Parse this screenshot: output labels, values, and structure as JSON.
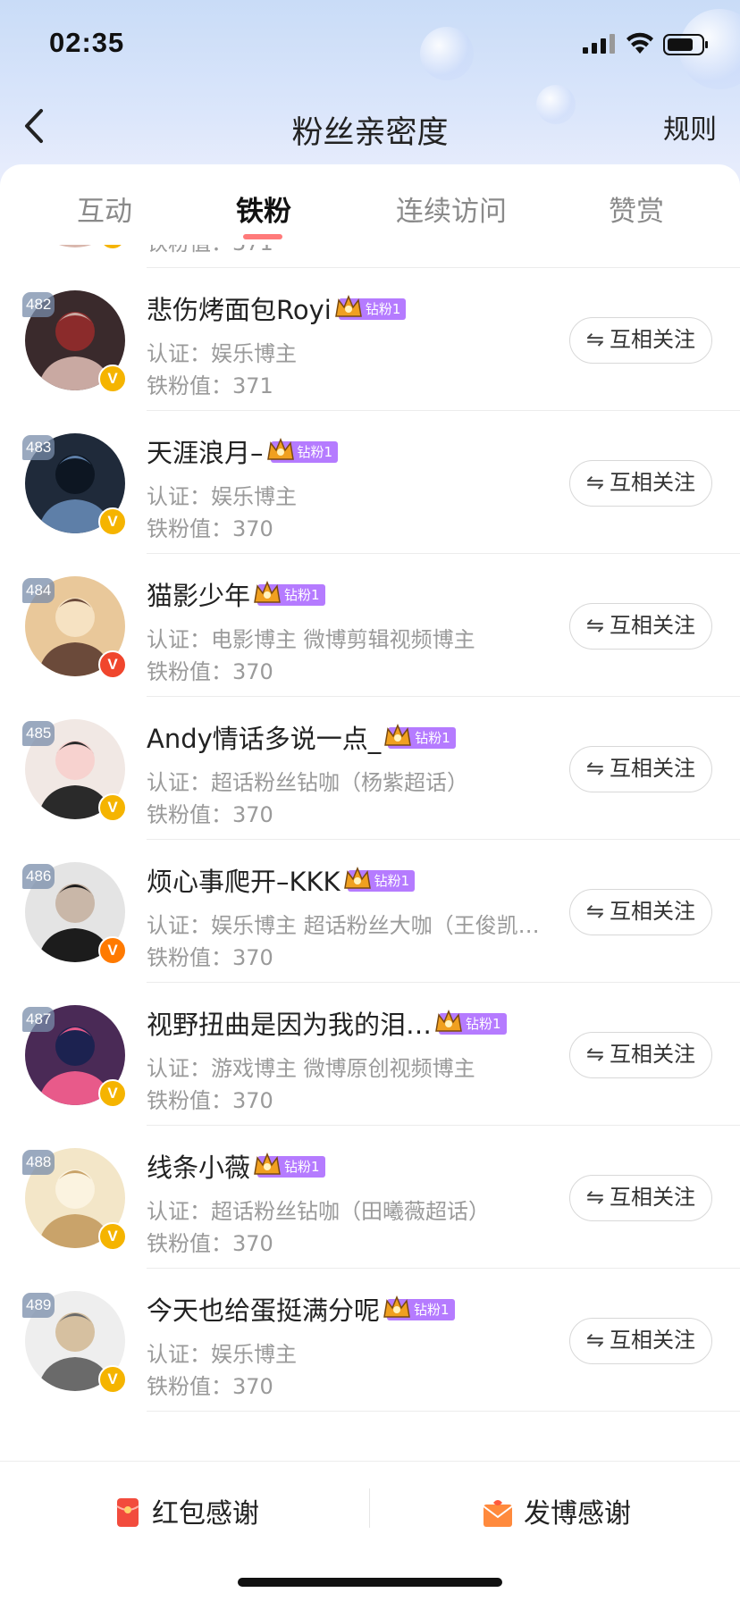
{
  "status": {
    "time": "02:35"
  },
  "nav": {
    "title": "粉丝亲密度",
    "rules": "规则"
  },
  "tabs": [
    {
      "label": "互动",
      "active": false
    },
    {
      "label": "铁粉",
      "active": true
    },
    {
      "label": "连续访问",
      "active": false
    },
    {
      "label": "赞赏",
      "active": false
    }
  ],
  "partial_row": {
    "score": "铁粉值：371"
  },
  "rows": [
    {
      "rank": "482",
      "name": "悲伤烤面包Royi",
      "badge": "钻粉1",
      "cert": "认证：娱乐博主",
      "score": "铁粉值：371",
      "follow": "互相关注",
      "verify": "gold"
    },
    {
      "rank": "483",
      "name": "天涯浪月–",
      "badge": "钻粉1",
      "cert": "认证：娱乐博主",
      "score": "铁粉值：370",
      "follow": "互相关注",
      "verify": "gold"
    },
    {
      "rank": "484",
      "name": "猫影少年",
      "badge": "钻粉1",
      "cert": "认证：电影博主 微博剪辑视频博主",
      "score": "铁粉值：370",
      "follow": "互相关注",
      "verify": "red"
    },
    {
      "rank": "485",
      "name": "Andy情话多说一点_",
      "badge": "钻粉1",
      "cert": "认证：超话粉丝钻咖（杨紫超话）",
      "score": "铁粉值：370",
      "follow": "互相关注",
      "verify": "gold"
    },
    {
      "rank": "486",
      "name": "烦心事爬开–KKK",
      "badge": "钻粉1",
      "cert": "认证：娱乐博主 超话粉丝大咖（王俊凯…",
      "score": "铁粉值：370",
      "follow": "互相关注",
      "verify": "orange"
    },
    {
      "rank": "487",
      "name": "视野扭曲是因为我的泪…",
      "badge": "钻粉1",
      "cert": "认证：游戏博主 微博原创视频博主",
      "score": "铁粉值：370",
      "follow": "互相关注",
      "verify": "gold"
    },
    {
      "rank": "488",
      "name": "线条小薇",
      "badge": "钻粉1",
      "cert": "认证：超话粉丝钻咖（田曦薇超话）",
      "score": "铁粉值：370",
      "follow": "互相关注",
      "verify": "gold"
    },
    {
      "rank": "489",
      "name": "今天也给蛋挺满分呢",
      "badge": "钻粉1",
      "cert": "认证：娱乐博主",
      "score": "铁粉值：370",
      "follow": "互相关注",
      "verify": "gold"
    }
  ],
  "bottom": {
    "red_packet": "红包感谢",
    "post": "发博感谢"
  },
  "colors": {
    "accent": "#ff7a7a",
    "badge": "#b57bff",
    "verify_gold": "#f5b400",
    "verify_red": "#f0462d",
    "verify_orange": "#ff7a00"
  }
}
